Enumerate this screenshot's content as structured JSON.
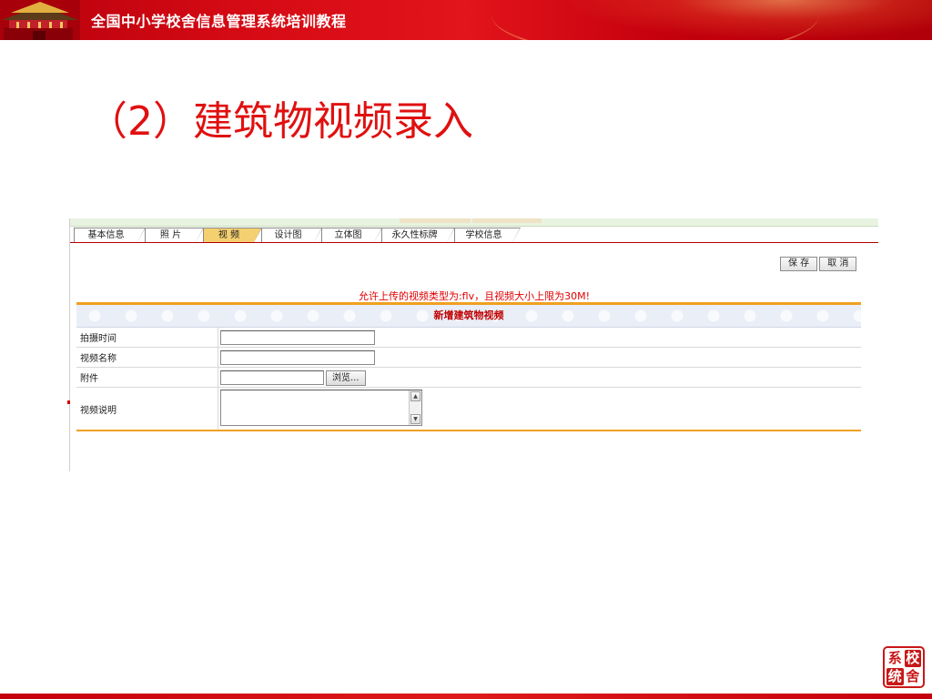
{
  "header": {
    "title": "全国中小学校舍信息管理系统培训教程"
  },
  "slide": {
    "title": "（2）建筑物视频录入"
  },
  "app": {
    "tabs": [
      {
        "label": "基本信息",
        "active": false
      },
      {
        "label": "照  片",
        "active": false
      },
      {
        "label": "视  频",
        "active": true
      },
      {
        "label": "设计图",
        "active": false
      },
      {
        "label": "立体图",
        "active": false
      },
      {
        "label": "永久性标牌",
        "active": false
      },
      {
        "label": "学校信息",
        "active": false
      }
    ],
    "toolbar": {
      "save_label": "保 存",
      "cancel_label": "取 消"
    },
    "notice": "允许上传的视频类型为:flv，且视频大小上限为30M!",
    "form": {
      "title": "新增建筑物视频",
      "fields": [
        {
          "label": "拍摄时间",
          "value": ""
        },
        {
          "label": "视频名称",
          "value": ""
        },
        {
          "label": "附件",
          "value": "",
          "browse_label": "浏览..."
        },
        {
          "label": "视频说明",
          "value": ""
        }
      ]
    }
  },
  "seal": {
    "chars": [
      "系",
      "校",
      "统",
      "舍"
    ]
  },
  "colors": {
    "brand_red": "#d40a14",
    "title_red": "#e01010",
    "active_tab": "#f5d070",
    "form_border": "#f0a020"
  }
}
